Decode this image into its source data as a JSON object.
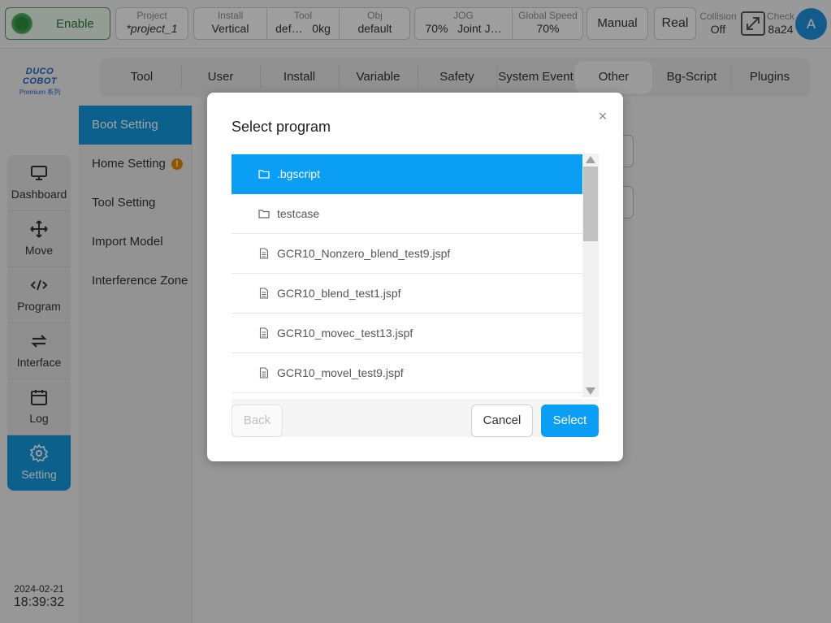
{
  "topbar": {
    "enable_label": "Enable",
    "project": {
      "key": "Project",
      "value": "*project_1"
    },
    "install": {
      "key": "Install",
      "value": "Vertical"
    },
    "tool": {
      "key": "Tool",
      "value": "def…",
      "value2": "0kg"
    },
    "obj": {
      "key": "Obj",
      "value": "default"
    },
    "jog": {
      "key": "JOG",
      "value": "70%",
      "value2": "Joint J…"
    },
    "global_speed": {
      "key": "Global Speed",
      "value": "70%"
    },
    "manual_label": "Manual",
    "real_label": "Real",
    "collision": {
      "key": "Collision",
      "value": "Off"
    },
    "check": {
      "key": "Check",
      "value": "8a24"
    },
    "avatar_letter": "A"
  },
  "logo": {
    "brand": "DUCO COBOT",
    "sub": "Premium 系列"
  },
  "leftnav": {
    "items": [
      {
        "label": "Dashboard",
        "icon": "monitor-icon"
      },
      {
        "label": "Move",
        "icon": "move-arrows-icon"
      },
      {
        "label": "Program",
        "icon": "code-icon"
      },
      {
        "label": "Interface",
        "icon": "swap-arrows-icon"
      },
      {
        "label": "Log",
        "icon": "calendar-icon"
      },
      {
        "label": "Setting",
        "icon": "gear-icon"
      }
    ],
    "active_label": "Setting"
  },
  "datetime": {
    "date": "2024-02-21",
    "time": "18:39:32"
  },
  "tabs": {
    "items": [
      "Tool",
      "User",
      "Install",
      "Variable",
      "Safety",
      "System Event",
      "Other",
      "Bg-Script",
      "Plugins"
    ],
    "active": "Other"
  },
  "submenu": {
    "items": [
      "Boot Setting",
      "Home Setting",
      "Tool Setting",
      "Import Model",
      "Interference Zone"
    ],
    "active": "Boot Setting",
    "warning_symbol": "!"
  },
  "modal": {
    "title": "Select program",
    "close_symbol": "×",
    "files": [
      {
        "name": ".bgscript",
        "type": "folder",
        "selected": true
      },
      {
        "name": "testcase",
        "type": "folder",
        "selected": false
      },
      {
        "name": "GCR10_Nonzero_blend_test9.jspf",
        "type": "file",
        "selected": false
      },
      {
        "name": "GCR10_blend_test1.jspf",
        "type": "file",
        "selected": false
      },
      {
        "name": "GCR10_movec_test13.jspf",
        "type": "file",
        "selected": false
      },
      {
        "name": "GCR10_movel_test9.jspf",
        "type": "file",
        "selected": false
      }
    ],
    "back_label": "Back",
    "cancel_label": "Cancel",
    "select_label": "Select"
  },
  "colors": {
    "accent": "#0a9ef5",
    "nav_active": "#1296db",
    "enable_green": "#2d8f3e",
    "warning": "#e08a00"
  }
}
